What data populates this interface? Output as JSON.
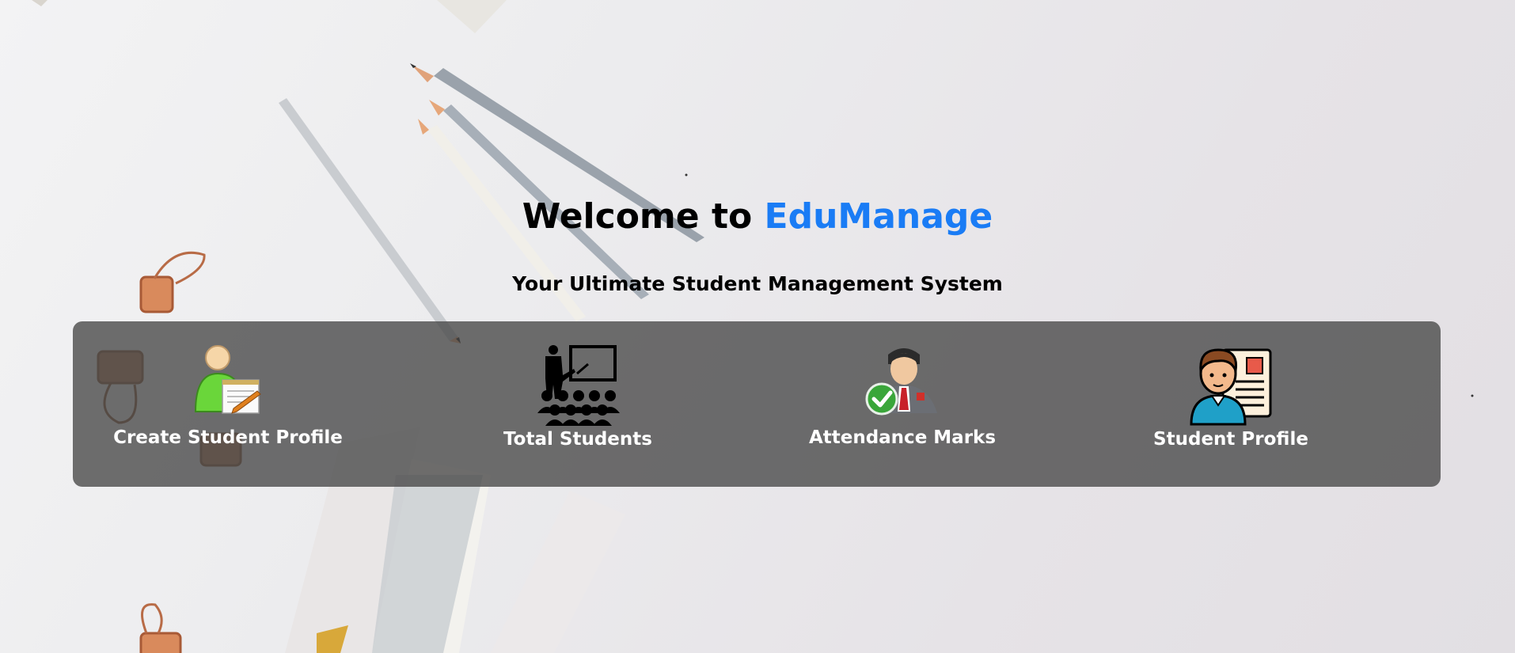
{
  "header": {
    "welcome_prefix": "Welcome to ",
    "brand_name": "EduManage",
    "tagline": "Your Ultimate Student Management System"
  },
  "colors": {
    "brand": "#1a7cf5",
    "panel_bg": "rgba(70,70,70,0.78)",
    "label": "#ffffff"
  },
  "cards": [
    {
      "label": "Create Student Profile",
      "icon": "create-profile-icon"
    },
    {
      "label": "Total Students",
      "icon": "classroom-icon"
    },
    {
      "label": "Attendance Marks",
      "icon": "attendance-icon"
    },
    {
      "label": "Student Profile",
      "icon": "student-profile-icon"
    }
  ]
}
